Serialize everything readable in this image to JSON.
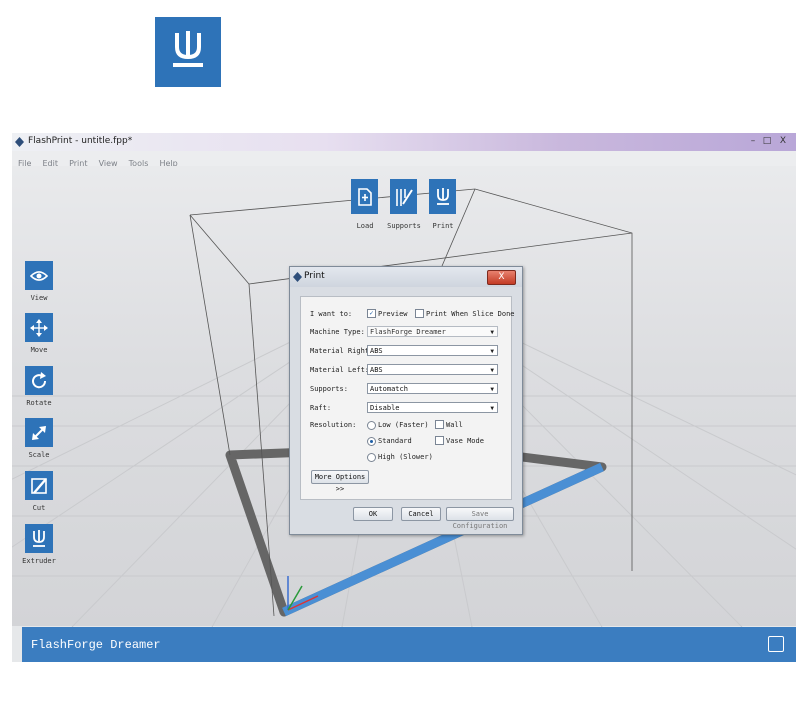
{
  "top_icon": {
    "name": "extruder-icon"
  },
  "window": {
    "title": "FlashPrint - untitle.fpp*",
    "controls": {
      "minimize": "–",
      "maximize": "□",
      "close": "X"
    }
  },
  "menu": {
    "items": [
      "File",
      "Edit",
      "Print",
      "View",
      "Tools",
      "Help"
    ]
  },
  "top_toolbar": [
    {
      "label": "Load",
      "icon": "load-icon"
    },
    {
      "label": "Supports",
      "icon": "supports-icon"
    },
    {
      "label": "Print",
      "icon": "print-icon"
    }
  ],
  "left_toolbar": [
    {
      "label": "View",
      "icon": "eye-icon"
    },
    {
      "label": "Move",
      "icon": "move-icon"
    },
    {
      "label": "Rotate",
      "icon": "rotate-icon"
    },
    {
      "label": "Scale",
      "icon": "scale-icon"
    },
    {
      "label": "Cut",
      "icon": "cut-icon"
    },
    {
      "label": "Extruder",
      "icon": "extruder-icon"
    }
  ],
  "status": {
    "machine": "FlashForge Dreamer"
  },
  "dialog": {
    "title": "Print",
    "close": "X",
    "want_to_label": "I want to:",
    "preview_label": "Preview",
    "preview_checked": true,
    "print_when_done_label": "Print When Slice Done",
    "print_when_done_checked": false,
    "machine_type_label": "Machine Type:",
    "machine_type_value": "FlashForge Dreamer",
    "material_right_label": "Material Right:",
    "material_right_value": "ABS",
    "material_left_label": "Material Left:",
    "material_left_value": "ABS",
    "supports_label": "Supports:",
    "supports_value": "Automatch",
    "raft_label": "Raft:",
    "raft_value": "Disable",
    "resolution_label": "Resolution:",
    "res_low": "Low (Faster)",
    "res_standard": "Standard",
    "res_high": "High (Slower)",
    "res_selected": "Standard",
    "wall_label": "Wall",
    "vase_label": "Vase Mode",
    "more_options": "More Options >>",
    "ok": "OK",
    "cancel": "Cancel",
    "save_config": "Save Configuration"
  },
  "colors": {
    "accent": "#2e73b8",
    "status_bar": "#3b7dc0",
    "build_plate_blue": "#4a8fd4"
  }
}
